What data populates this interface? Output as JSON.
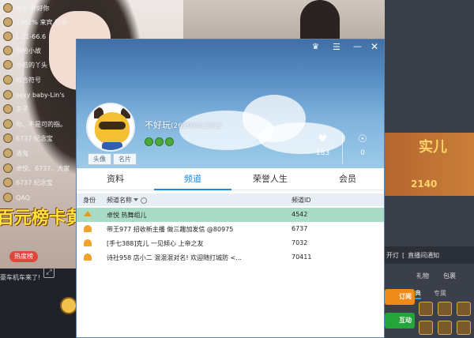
{
  "stream": {
    "banner_text": "百元榜卡黄",
    "hot_badge": "热度榜",
    "car_text": "豪车机车来了!"
  },
  "chat": {
    "lines": [
      {
        "text": "村长 你好你"
      },
      {
        "text": "7962% 来宾 打你"
      },
      {
        "text": "L-21-66.6"
      },
      {
        "text": "啊哈小故"
      },
      {
        "text": "小若的丫头"
      },
      {
        "text": "综合符号"
      },
      {
        "text": "sexy baby-Lin's"
      },
      {
        "text": "夫子"
      },
      {
        "text": "你、不是可的指。"
      },
      {
        "text": "6737 纪念宝"
      },
      {
        "text": "酒鬼"
      },
      {
        "text": "卓悦、6737、大家"
      },
      {
        "text": "6737 纪念宝"
      },
      {
        "text": "QAQ"
      }
    ],
    "toolbar": {
      "item1": "开灯",
      "item2": "直播间通知"
    },
    "tab_gift": "礼物",
    "tab_bag": "包裹",
    "tab_classic": "经典",
    "tab_special": "专属",
    "btn_follow": "订阅",
    "btn_interact": "互动"
  },
  "profile": {
    "window_buttons": {
      "skin": "♛",
      "menu": "☰",
      "min": "—",
      "close": "✕"
    },
    "name": "不好玩",
    "id": "(2620341552)",
    "avatar_link": "头像",
    "card_link": "名片",
    "likes_icon": "heart-icon",
    "likes": "183",
    "fans": "0",
    "level_count": 3,
    "tabs": [
      "资料",
      "频道",
      "荣誉人生",
      "会员"
    ],
    "active_tab": 1
  },
  "channel_table": {
    "headers": {
      "role": "身份",
      "name": "频道名称",
      "id": "频道ID"
    },
    "rows": [
      {
        "role": "crown",
        "name": "卓悦  热舞组儿",
        "id": "4542"
      },
      {
        "role": "person",
        "name": "带王977  招收新主播  做三趣加发信 @80975",
        "id": "6737"
      },
      {
        "role": "person",
        "name": "[手七388]克儿    一见倾心   上帝之友",
        "id": "7032"
      },
      {
        "role": "person",
        "name": "诗社958   店小二   混混混对名!  欢迎随打城防 <...",
        "id": "70411"
      }
    ]
  }
}
